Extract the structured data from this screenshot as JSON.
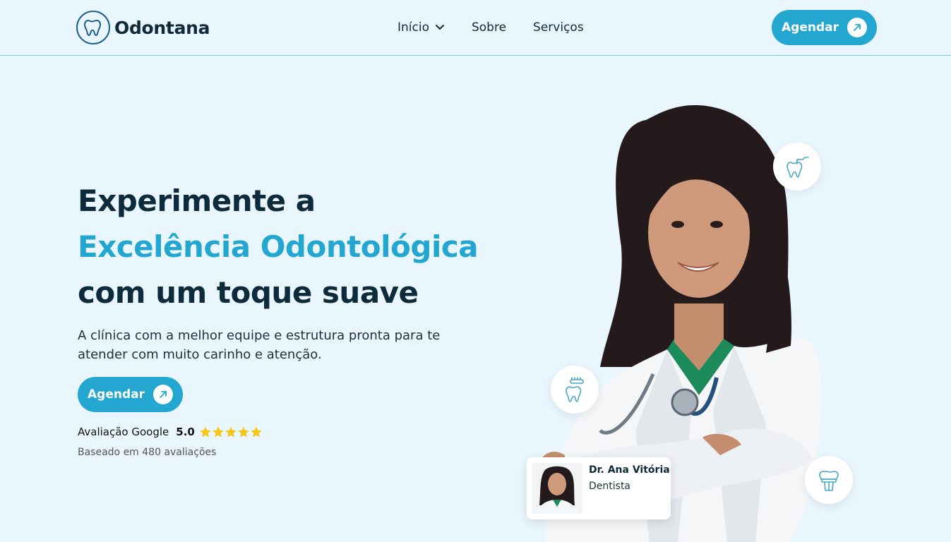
{
  "brand": {
    "name": "Odontana",
    "accent_color": "#23a6cf",
    "dark_color": "#0d2b3a"
  },
  "nav": {
    "items": [
      {
        "label": "Início",
        "icon": "chevron-down-icon"
      },
      {
        "label": "Sobre"
      },
      {
        "label": "Serviços"
      }
    ]
  },
  "header": {
    "cta_label": "Agendar",
    "cta_icon": "arrow-up-right-icon"
  },
  "hero": {
    "title_line1": "Experimente a",
    "title_line2": "Excelência Odontológica",
    "title_line3": "com um toque suave",
    "subtitle": "A clínica com a melhor equipe e estrutura pronta para te atender com muito carinho e atenção.",
    "cta_label": "Agendar",
    "rating_label": "Avaliação Google",
    "rating_score": "5.0",
    "rating_stars": 5,
    "rating_note": "Baseado em 480 avaliações"
  },
  "doctor_card": {
    "name": "Dr. Ana Vitória",
    "role": "Dentista"
  },
  "floating_icons": [
    "tooth-drill-icon",
    "toothbrush-tooth-icon",
    "dental-crown-icon"
  ]
}
